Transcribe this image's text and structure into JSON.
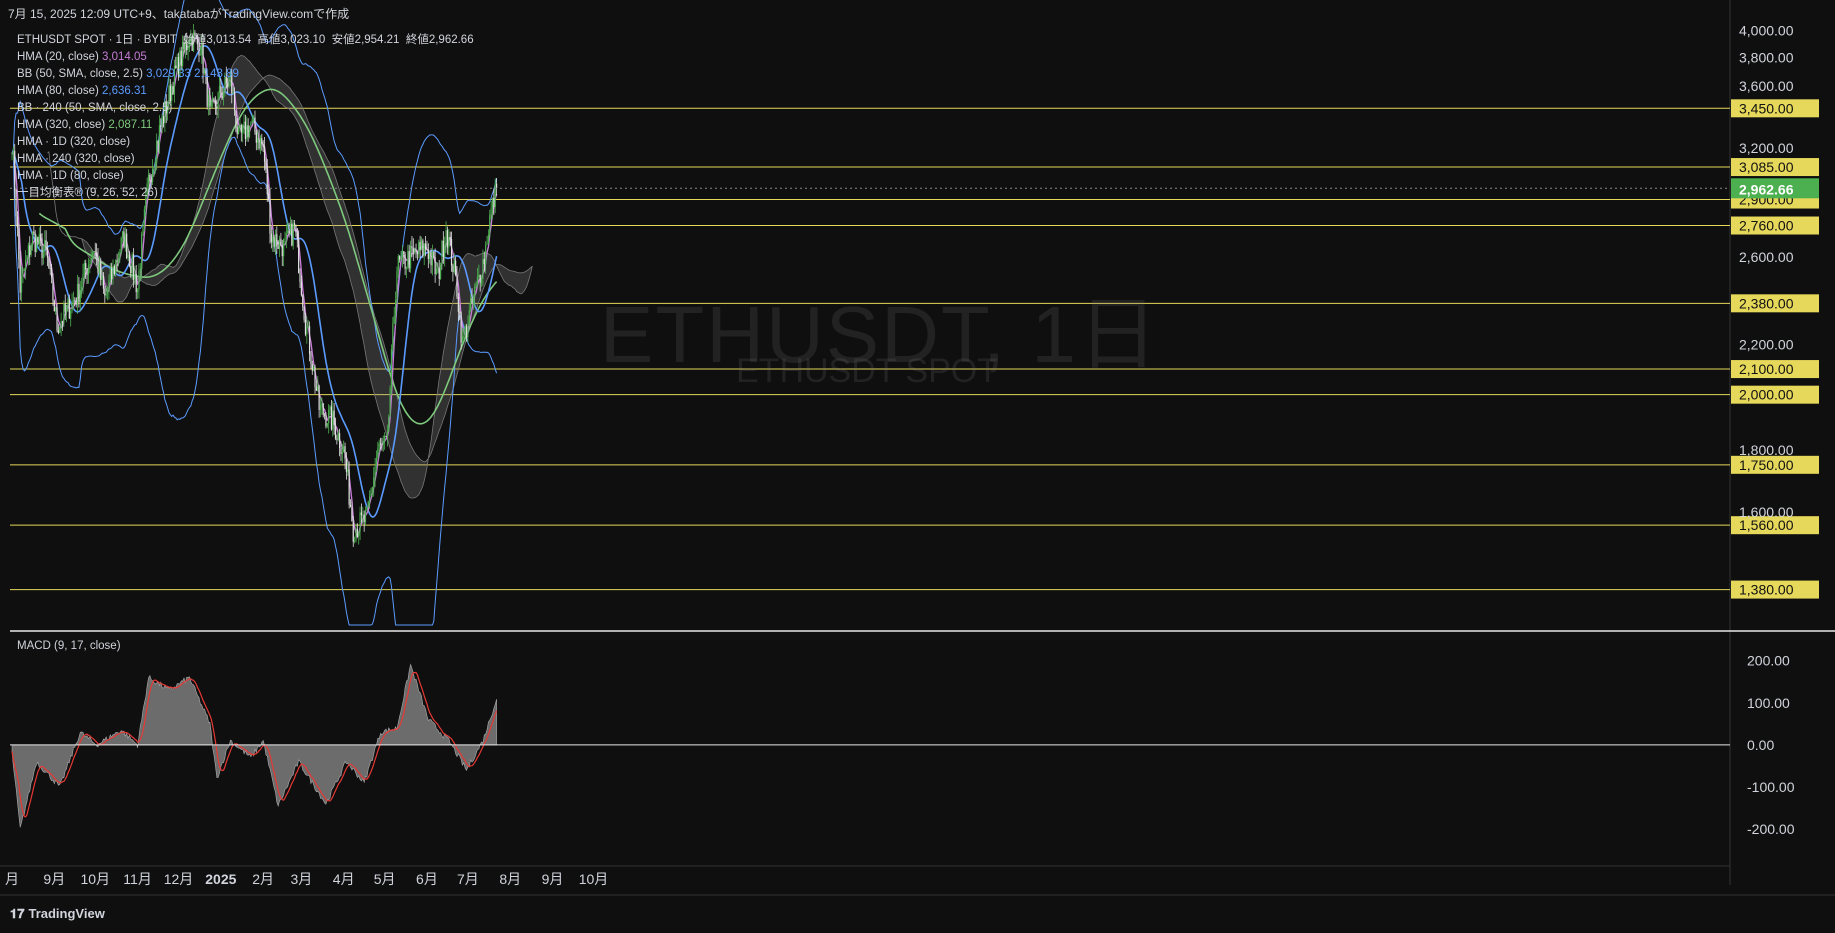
{
  "header": {
    "timestamp": "7月 15, 2025 12:09 UTC+9、takatabaがTradingView.comで作成"
  },
  "symbol_line": {
    "symbol": "ETHUSDT SPOT · 1日 · BYBIT",
    "open_label": "始値",
    "open": "3,013.54",
    "high_label": "高値",
    "high": "3,023.10",
    "low_label": "安値",
    "low": "2,954.21",
    "close_label": "終値",
    "close": "2,962.66"
  },
  "indicators": [
    {
      "name": "HMA (20, close)",
      "value": "3,014.05",
      "color": "#c77dd6"
    },
    {
      "name": "BB (50, SMA, close, 2.5)",
      "value": "3,029.33  2,143.89",
      "color": "#5b9bff"
    },
    {
      "name": "HMA (80, close)",
      "value": "2,636.31",
      "color": "#5b9bff"
    },
    {
      "name": "BB · 240 (50, SMA, close, 2.5)",
      "value": "",
      "color": ""
    },
    {
      "name": "HMA (320, close)",
      "value": "2,087.11",
      "color": "#7ec97e"
    },
    {
      "name": "HMA · 1D (320, close)",
      "value": "",
      "color": ""
    },
    {
      "name": "HMA · 240 (320, close)",
      "value": "",
      "color": ""
    },
    {
      "name": "HMA · 1D (80, close)",
      "value": "",
      "color": ""
    },
    {
      "name": "一目均衡表® (9, 26, 52, 26)",
      "value": "",
      "color": ""
    }
  ],
  "watermark": {
    "main": "ETHUSDT, 1日",
    "sub": "ETHUSDT SPOT"
  },
  "macd_label": "MACD (9, 17, close)",
  "branding": "TradingView",
  "colors": {
    "background": "#0f0f0f",
    "up": "#4caf50",
    "down": "#e0e0e0",
    "hma20": "#c77dd6",
    "bb": "#5b9bff",
    "hma80": "#5b9bff",
    "hma320": "#7ec97e",
    "level_line": "#e6d85a",
    "price_tag": "#4caf50",
    "macd_signal": "#e53935",
    "macd_hist": "#8a8a8a"
  },
  "chart_data": [
    {
      "type": "line",
      "title": "ETHUSDT SPOT · 1日 · BYBIT",
      "x_tick_labels": [
        "月",
        "9月",
        "10月",
        "11月",
        "12月",
        "2025",
        "2月",
        "3月",
        "4月",
        "5月",
        "6月",
        "7月",
        "8月",
        "9月",
        "10月"
      ],
      "x_tick_index": [
        0,
        31,
        61,
        92,
        122,
        153,
        184,
        212,
        243,
        273,
        304,
        334,
        365,
        396,
        426
      ],
      "y_tick_labels": [
        "4,000.00",
        "3,800.00",
        "3,600.00",
        "3,200.00",
        "2,600.00",
        "2,200.00",
        "1,800.00",
        "1,600.00"
      ],
      "y_tick_values": [
        4000,
        3800,
        3600,
        3200,
        2600,
        2200,
        1800,
        1600
      ],
      "ylim": [
        1290,
        4020
      ],
      "scale": "log",
      "horizontal_levels": [
        {
          "label": "3,450.00",
          "value": 3450
        },
        {
          "label": "3,085.00",
          "value": 3085
        },
        {
          "label": "2,900.00",
          "value": 2900
        },
        {
          "label": "2,760.00",
          "value": 2760
        },
        {
          "label": "2,380.00",
          "value": 2380
        },
        {
          "label": "2,100.00",
          "value": 2100
        },
        {
          "label": "2,000.00",
          "value": 2000
        },
        {
          "label": "1,750.00",
          "value": 1750
        },
        {
          "label": "1,560.00",
          "value": 1560
        },
        {
          "label": "1,380.00",
          "value": 1380
        }
      ],
      "current_price": {
        "label": "2,962.66",
        "value": 2962.66
      },
      "price_anchors": [
        {
          "i": 0,
          "p": 3250
        },
        {
          "i": 6,
          "p": 2450
        },
        {
          "i": 15,
          "p": 2700
        },
        {
          "i": 25,
          "p": 2620
        },
        {
          "i": 33,
          "p": 2280
        },
        {
          "i": 48,
          "p": 2420
        },
        {
          "i": 60,
          "p": 2650
        },
        {
          "i": 68,
          "p": 2400
        },
        {
          "i": 82,
          "p": 2700
        },
        {
          "i": 92,
          "p": 2450
        },
        {
          "i": 100,
          "p": 3000
        },
        {
          "i": 108,
          "p": 3300
        },
        {
          "i": 120,
          "p": 3700
        },
        {
          "i": 130,
          "p": 3950
        },
        {
          "i": 138,
          "p": 3900
        },
        {
          "i": 145,
          "p": 3400
        },
        {
          "i": 153,
          "p": 3550
        },
        {
          "i": 160,
          "p": 3650
        },
        {
          "i": 166,
          "p": 3250
        },
        {
          "i": 175,
          "p": 3350
        },
        {
          "i": 184,
          "p": 3200
        },
        {
          "i": 190,
          "p": 2700
        },
        {
          "i": 200,
          "p": 2650
        },
        {
          "i": 207,
          "p": 2750
        },
        {
          "i": 215,
          "p": 2300
        },
        {
          "i": 225,
          "p": 1950
        },
        {
          "i": 235,
          "p": 1900
        },
        {
          "i": 243,
          "p": 1800
        },
        {
          "i": 250,
          "p": 1550
        },
        {
          "i": 260,
          "p": 1580
        },
        {
          "i": 268,
          "p": 1800
        },
        {
          "i": 275,
          "p": 1820
        },
        {
          "i": 282,
          "p": 2550
        },
        {
          "i": 292,
          "p": 2600
        },
        {
          "i": 304,
          "p": 2650
        },
        {
          "i": 312,
          "p": 2500
        },
        {
          "i": 318,
          "p": 2750
        },
        {
          "i": 326,
          "p": 2450
        },
        {
          "i": 330,
          "p": 2200
        },
        {
          "i": 340,
          "p": 2450
        },
        {
          "i": 346,
          "p": 2600
        },
        {
          "i": 350,
          "p": 2800
        },
        {
          "i": 355,
          "p": 2962
        }
      ],
      "macd_anchors": [
        {
          "i": 0,
          "v": -20
        },
        {
          "i": 6,
          "v": -200
        },
        {
          "i": 18,
          "v": -40
        },
        {
          "i": 35,
          "v": -100
        },
        {
          "i": 50,
          "v": 30
        },
        {
          "i": 62,
          "v": 0
        },
        {
          "i": 80,
          "v": 35
        },
        {
          "i": 92,
          "v": 0
        },
        {
          "i": 100,
          "v": 160
        },
        {
          "i": 115,
          "v": 130
        },
        {
          "i": 130,
          "v": 160
        },
        {
          "i": 145,
          "v": 50
        },
        {
          "i": 150,
          "v": -80
        },
        {
          "i": 160,
          "v": 10
        },
        {
          "i": 175,
          "v": -30
        },
        {
          "i": 184,
          "v": 10
        },
        {
          "i": 195,
          "v": -145
        },
        {
          "i": 210,
          "v": -40
        },
        {
          "i": 230,
          "v": -140
        },
        {
          "i": 245,
          "v": -40
        },
        {
          "i": 258,
          "v": -90
        },
        {
          "i": 270,
          "v": 30
        },
        {
          "i": 282,
          "v": 40
        },
        {
          "i": 292,
          "v": 190
        },
        {
          "i": 305,
          "v": 60
        },
        {
          "i": 320,
          "v": 10
        },
        {
          "i": 333,
          "v": -60
        },
        {
          "i": 345,
          "v": 10
        },
        {
          "i": 355,
          "v": 110
        }
      ],
      "macd_y_tick_labels": [
        "200.00",
        "100.00",
        "0.00",
        "-100.00",
        "-200.00"
      ],
      "macd_y_tick_values": [
        200,
        100,
        0,
        -100,
        -200
      ],
      "macd_ylim": [
        -240,
        230
      ]
    }
  ]
}
